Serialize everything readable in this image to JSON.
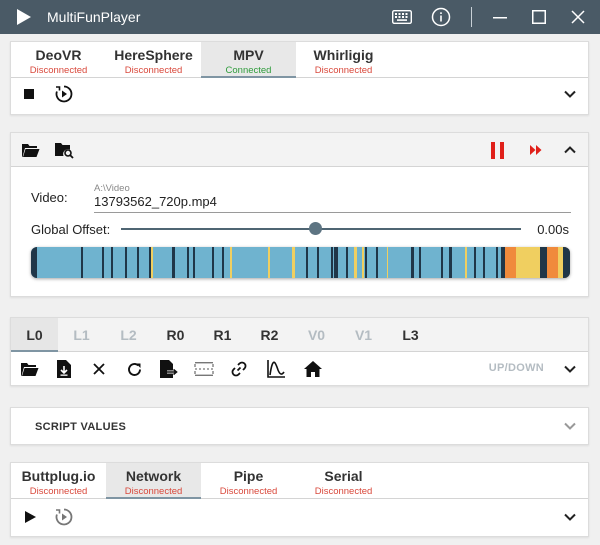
{
  "app": {
    "title": "MultiFunPlayer"
  },
  "window_controls": [
    "keyboard-icon",
    "info-icon",
    "minimize-icon",
    "maximize-icon",
    "close-icon"
  ],
  "media_sources": {
    "tabs": [
      {
        "name": "DeoVR",
        "status": "Disconnected",
        "active": false
      },
      {
        "name": "HereSphere",
        "status": "Disconnected",
        "active": false
      },
      {
        "name": "MPV",
        "status": "Connected",
        "active": true
      },
      {
        "name": "Whirligig",
        "status": "Disconnected",
        "active": false
      }
    ],
    "toolbar": [
      "stop-icon",
      "timer-play-icon",
      "chevron-down-icon"
    ]
  },
  "video": {
    "toolbar": [
      "folder-open-icon",
      "folder-search-icon",
      "pause-icon",
      "fast-forward-icon",
      "chevron-up-icon"
    ],
    "label": "Video:",
    "path": "A:\\Video",
    "file": "13793562_720p.mp4",
    "offset_label": "Global Offset:",
    "offset_value": "0.00s",
    "offset_level": 0.485,
    "heatmap_colors": {
      "base": "#6fb3cf",
      "dark": "#203648",
      "yellow": "#f0cf60",
      "orange": "#f08a3c"
    }
  },
  "axes": {
    "tabs": [
      {
        "name": "L0",
        "active": true,
        "dim": false
      },
      {
        "name": "L1",
        "active": false,
        "dim": true
      },
      {
        "name": "L2",
        "active": false,
        "dim": true
      },
      {
        "name": "R0",
        "active": false,
        "dim": false
      },
      {
        "name": "R1",
        "active": false,
        "dim": false
      },
      {
        "name": "R2",
        "active": false,
        "dim": false
      },
      {
        "name": "V0",
        "active": false,
        "dim": true
      },
      {
        "name": "V1",
        "active": false,
        "dim": true
      },
      {
        "name": "L3",
        "active": false,
        "dim": false
      }
    ],
    "toolbar": [
      "folder-open-icon",
      "file-import-icon",
      "close-icon",
      "refresh-icon",
      "file-export-icon",
      "wrap-icon",
      "link-icon",
      "chart-curve-icon",
      "home-icon"
    ],
    "axis_label": "UP/DOWN"
  },
  "script_values": {
    "label": "SCRIPT VALUES"
  },
  "outputs": {
    "tabs": [
      {
        "name": "Buttplug.io",
        "status": "Disconnected",
        "active": false
      },
      {
        "name": "Network",
        "status": "Disconnected",
        "active": true
      },
      {
        "name": "Pipe",
        "status": "Disconnected",
        "active": false
      },
      {
        "name": "Serial",
        "status": "Disconnected",
        "active": false
      }
    ],
    "toolbar": [
      "play-icon",
      "timer-play-icon",
      "chevron-down-icon"
    ]
  }
}
